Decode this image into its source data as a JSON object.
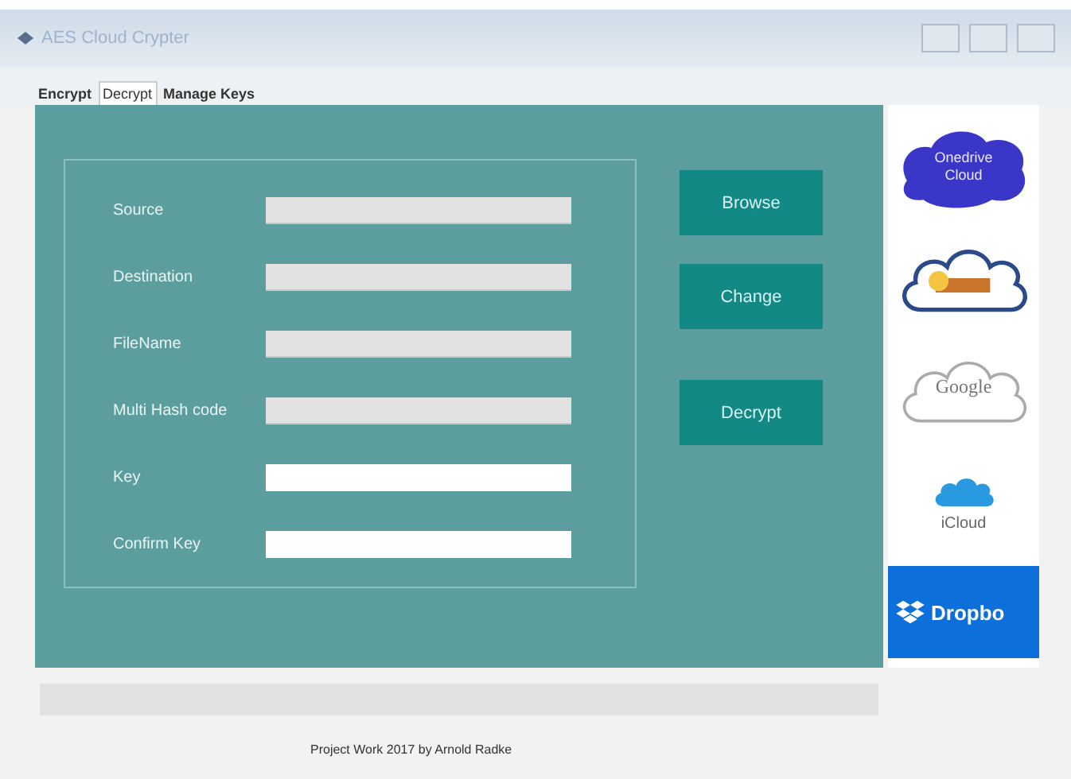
{
  "window": {
    "title": "AES Cloud Crypter"
  },
  "tabs": [
    {
      "label": "Encrypt",
      "selected": false
    },
    {
      "label": "Decrypt",
      "selected": true
    },
    {
      "label": "Manage Keys",
      "selected": false
    }
  ],
  "fields": [
    {
      "label": "Source",
      "disabled": true
    },
    {
      "label": "Destination",
      "disabled": true
    },
    {
      "label": "FileName",
      "disabled": true
    },
    {
      "label": "Multi Hash code",
      "disabled": true
    },
    {
      "label": "Key",
      "disabled": false
    },
    {
      "label": "Confirm Key",
      "disabled": false
    }
  ],
  "buttons": [
    "Browse",
    "Change",
    "Decrypt"
  ],
  "cloud_services": [
    {
      "kind": "onedrive",
      "label": "Onedrive Cloud"
    },
    {
      "kind": "owncloud"
    },
    {
      "kind": "google",
      "label": "Google"
    },
    {
      "kind": "icloud",
      "label": "iCloud"
    },
    {
      "kind": "dropbox",
      "label": "Dropbo"
    }
  ],
  "footer": "Project Work 2017 by Arnold Radke"
}
